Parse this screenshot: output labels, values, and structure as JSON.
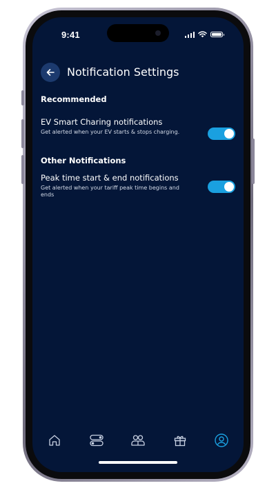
{
  "status_bar": {
    "time": "9:41"
  },
  "header": {
    "title": "Notification Settings",
    "back_icon": "arrow-left-icon"
  },
  "sections": [
    {
      "heading": "Recommended",
      "items": [
        {
          "title": "EV Smart Charing notifications",
          "description": "Get alerted when your EV starts & stops charging.",
          "enabled": true
        }
      ]
    },
    {
      "heading": "Other Notifications",
      "items": [
        {
          "title": "Peak time start & end notifications",
          "description": "Get alerted when your tariff peak time begins and ends",
          "enabled": true
        }
      ]
    }
  ],
  "tab_bar": {
    "tabs": [
      {
        "icon": "home-icon",
        "active": false
      },
      {
        "icon": "toggles-icon",
        "active": false
      },
      {
        "icon": "community-icon",
        "active": false
      },
      {
        "icon": "gift-icon",
        "active": false
      },
      {
        "icon": "profile-icon",
        "active": true
      }
    ]
  },
  "colors": {
    "background": "#041638",
    "accent": "#1aa0e0",
    "back_button": "#1c3a6e",
    "inactive_icon": "#c9d2e3"
  }
}
